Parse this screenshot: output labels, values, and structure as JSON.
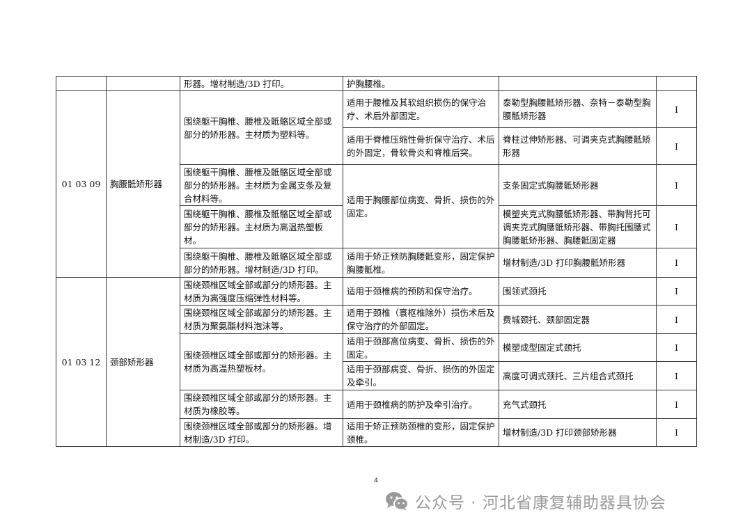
{
  "rows": [
    {
      "code": "",
      "name": "",
      "desc": "形器。增材制造/3D 打印。",
      "use": "护胸腰椎。",
      "prod": "",
      "cls": ""
    },
    {
      "code": "01 03 09",
      "name": "胸腰骶矫形器",
      "desc": "围绕躯干胸椎、腰椎及骶骼区域全部或部分的矫形器。主材质为塑料等。",
      "use": "适用于腰椎及其软组织损伤的保守治疗、术后外部固定。",
      "prod": "泰勒型胸腰骶矫形器、奈特－泰勒型胸腰骶矫形器",
      "cls": "I"
    },
    {
      "code": "",
      "name": "",
      "desc": "",
      "use": "适用于脊椎压缩性骨折保守治疗、术后的外固定，骨软骨炎和脊椎后突。",
      "prod": "脊柱过伸矫形器、可调夹克式胸腰骶矫形器",
      "cls": "I"
    },
    {
      "code": "",
      "name": "",
      "desc": "围绕躯干胸椎、腰椎及骶骼区域全部或部分的矫形器。主材质为金属支条及复合材料等。",
      "use": "适用于胸腰部位病变、骨折、损伤的外固定。",
      "prod": "支条固定式胸腰骶矫形器",
      "cls": "I"
    },
    {
      "code": "",
      "name": "",
      "desc": "围绕躯干胸椎、腰椎及骶骼区域全部或部分的矫形器。主材质为高温热塑板材。",
      "use": "",
      "prod": "模塑夹克式胸腰骶矫形器、带胸背托可调夹克式胸腰骶矫形器、带胸托围腰式胸腰骶矫形器、胸腰骶固定器",
      "cls": "I"
    },
    {
      "code": "",
      "name": "",
      "desc": "围绕躯干胸椎、腰椎及骶骼区域全部或部分的矫形器。增材制造/3D 打印。",
      "use": "适用于矫正预防胸腰骶变形，固定保护胸腰骶椎。",
      "prod": "增材制造/3D 打印胸腰骶矫形器",
      "cls": "I"
    },
    {
      "code": "01 03 12",
      "name": "颈部矫形器",
      "desc": "围绕颈椎区域全部或部分的矫形器。主材质为高强度压缩弹性材料等。",
      "use": "适用于颈椎病的预防和保守治疗。",
      "prod": "围领式颈托",
      "cls": "I"
    },
    {
      "code": "",
      "name": "",
      "desc": "围绕颈椎区域全部或部分的矫形器。主材质为聚氨酯材料泡沫等。",
      "use": "适用于颈椎（寰枢椎除外）损伤术后及保守治疗的外部固定。",
      "prod": "费城颈托、颈部固定器",
      "cls": "I"
    },
    {
      "code": "",
      "name": "",
      "desc": "围绕颈椎区域全部或部分的矫形器。主材质为高温热塑板材。",
      "use": "适用于颈部高位病变、骨折、损伤的外固定。",
      "prod": "模塑成型固定式颈托",
      "cls": "I"
    },
    {
      "code": "",
      "name": "",
      "desc": "",
      "use": "适用于颈部病变、骨折、损伤的外固定及牵引。",
      "prod": "高度可调式颈托、三片组合式颈托",
      "cls": "I"
    },
    {
      "code": "",
      "name": "",
      "desc": "围绕颈椎区域全部或部分的矫形器。主材质为橡胶等。",
      "use": "适用于颈椎病的防护及牵引治疗。",
      "prod": "充气式颈托",
      "cls": "I"
    },
    {
      "code": "",
      "name": "",
      "desc": "围绕颈椎区域全部或部分的矫形器。增材制造/3D 打印。",
      "use": "适用于矫正预防颈椎的变形，固定保护颈椎。",
      "prod": "增材制造/3D 打印颈部矫形器",
      "cls": "I"
    }
  ],
  "page_number": "4",
  "footer": {
    "text": "公众号 · 河北省康复辅助器具协会",
    "icon": "wechat-icon"
  }
}
